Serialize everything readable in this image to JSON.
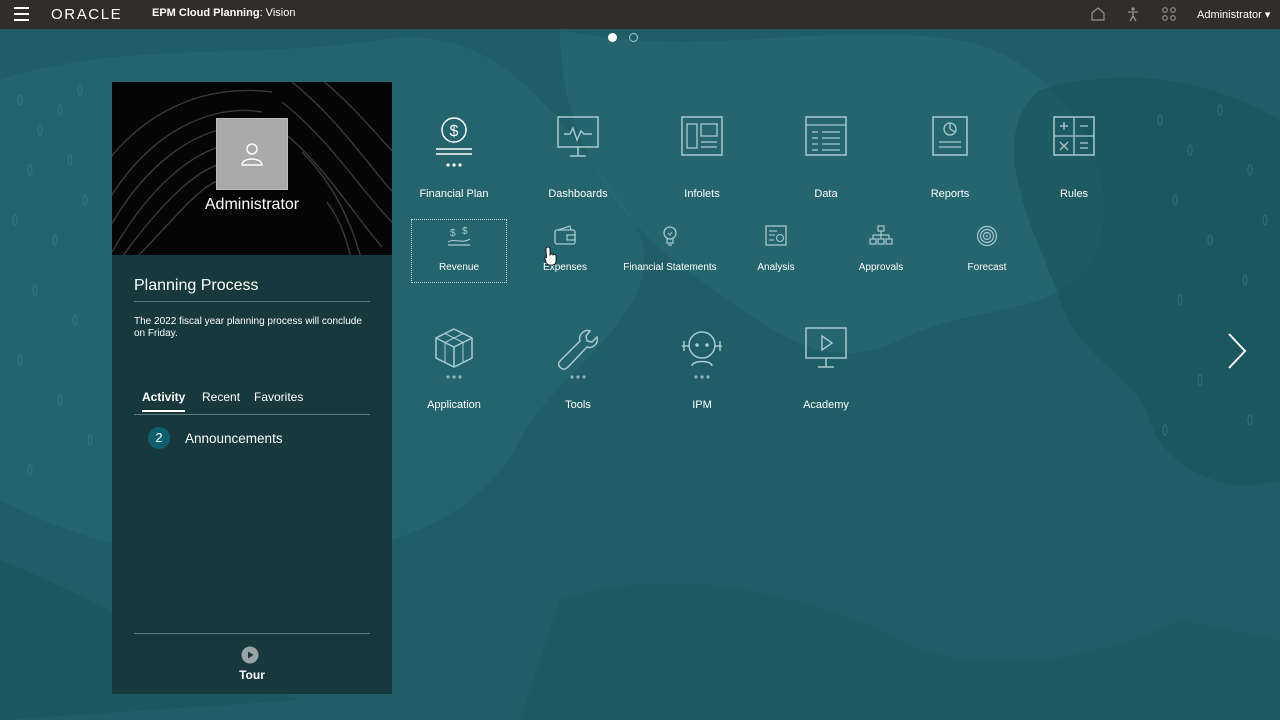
{
  "topbar": {
    "logo": "ORACLE",
    "app_title_bold": "EPM Cloud Planning",
    "app_title_rest": ": Vision",
    "icons": [
      "home-icon",
      "accessibility-icon",
      "navigator-icon"
    ],
    "user_menu": "Administrator ▾"
  },
  "pagination": {
    "pages": 2,
    "active": 1
  },
  "panel": {
    "username": "Administrator",
    "process_title": "Planning Process",
    "process_message": "The 2022 fiscal year planning process will conclude on Friday.",
    "tabs": [
      {
        "label": "Activity",
        "active": true
      },
      {
        "label": "Recent",
        "active": false
      },
      {
        "label": "Favorites",
        "active": false
      }
    ],
    "announcements": {
      "count": "2",
      "label": "Announcements"
    },
    "tour_label": "Tour"
  },
  "cards_row1": [
    {
      "label": "Financial Plan",
      "icon": "dollar-icon"
    },
    {
      "label": "Dashboards",
      "icon": "monitor-pulse-icon"
    },
    {
      "label": "Infolets",
      "icon": "infolets-icon"
    },
    {
      "label": "Data",
      "icon": "data-grid-icon"
    },
    {
      "label": "Reports",
      "icon": "report-icon"
    },
    {
      "label": "Rules",
      "icon": "calculator-icon"
    }
  ],
  "cards_row2": [
    {
      "label": "Revenue",
      "icon": "revenue-icon"
    },
    {
      "label": "Expenses",
      "icon": "wallet-icon"
    },
    {
      "label": "Financial Statements",
      "icon": "lightbulb-icon"
    },
    {
      "label": "Analysis",
      "icon": "analysis-icon"
    },
    {
      "label": "Approvals",
      "icon": "hierarchy-icon"
    },
    {
      "label": "Forecast",
      "icon": "target-icon"
    }
  ],
  "cards_row3": [
    {
      "label": "Application",
      "icon": "cube-icon"
    },
    {
      "label": "Tools",
      "icon": "wrench-icon"
    },
    {
      "label": "IPM",
      "icon": "robot-icon"
    },
    {
      "label": "Academy",
      "icon": "play-screen-icon"
    }
  ],
  "colors": {
    "background": "#1f5e67",
    "topbar": "#312d2a",
    "panel": "#17393e"
  }
}
